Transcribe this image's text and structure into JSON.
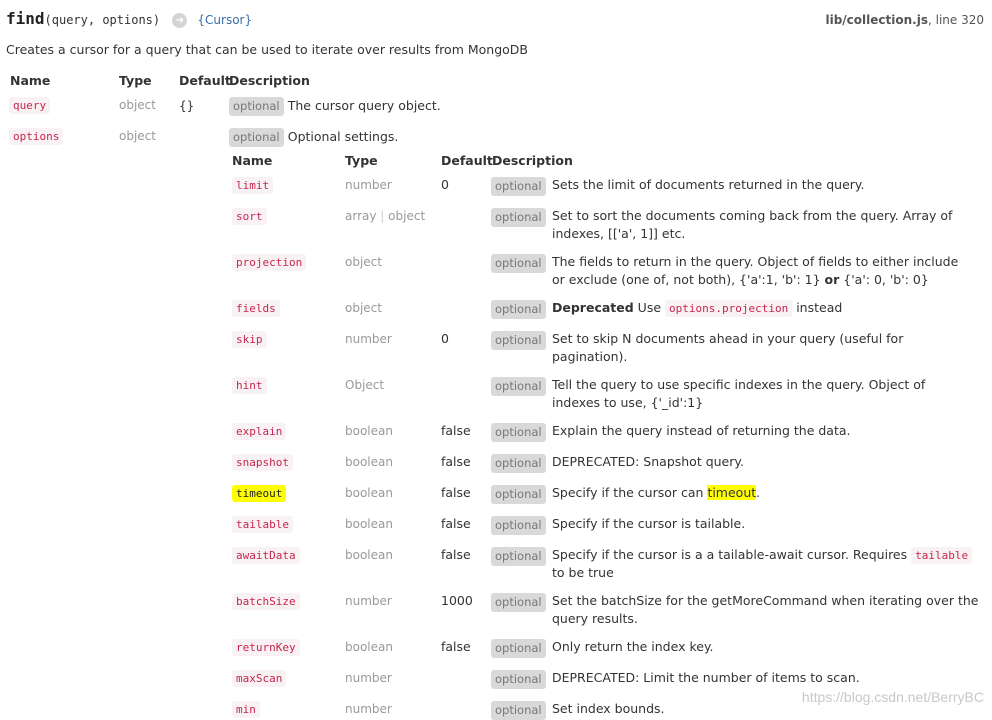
{
  "header": {
    "fn_name": "find",
    "fn_params": "(query, options)",
    "return_type": "{Cursor}",
    "source_file": "lib/collection.js",
    "source_line_label": ", line 320",
    "description": "Creates a cursor for a query that can be used to iterate over results from MongoDB"
  },
  "outer_headers": {
    "name": "Name",
    "type": "Type",
    "default": "Default",
    "description": "Description"
  },
  "outer_rows": [
    {
      "name": "query",
      "type": "object",
      "default": "{}",
      "badge": "optional",
      "desc": "The cursor query object."
    },
    {
      "name": "options",
      "type": "object",
      "default": "",
      "badge": "optional",
      "desc": "Optional settings."
    }
  ],
  "inner_headers": {
    "name": "Name",
    "type": "Type",
    "default": "Default",
    "description": "Description"
  },
  "inner_rows": [
    {
      "name": "limit",
      "type": "number",
      "default": "0",
      "badge": "optional",
      "desc_line1": "Sets the limit of documents returned in the query.",
      "desc_line2": ""
    },
    {
      "name": "sort",
      "type_a": "array",
      "type_sep": "|",
      "type_b": "object",
      "default": "",
      "badge": "optional",
      "desc_line1": "Set to sort the documents coming back from the query. Array of",
      "desc_line2": "indexes, [['a', 1]] etc."
    },
    {
      "name": "projection",
      "type": "object",
      "default": "",
      "badge": "optional",
      "desc_line1": "The fields to return in the query. Object of fields to either include",
      "desc_line2a": "or exclude (one of, not both), {'a':1, 'b': 1} ",
      "desc_line2_or": "or",
      "desc_line2b": " {'a': 0, 'b': 0}"
    },
    {
      "name": "fields",
      "type": "object",
      "default": "",
      "badge": "optional",
      "desc_bold": "Deprecated",
      "desc_use": " Use ",
      "desc_code": "options.projection",
      "desc_end": " instead"
    },
    {
      "name": "skip",
      "type": "number",
      "default": "0",
      "badge": "optional",
      "desc_line1": "Set to skip N documents ahead in your query (useful for",
      "desc_line2": "pagination)."
    },
    {
      "name": "hint",
      "type": "Object",
      "default": "",
      "badge": "optional",
      "desc_line1": "Tell the query to use specific indexes in the query. Object of",
      "desc_line2": "indexes to use, {'_id':1}"
    },
    {
      "name": "explain",
      "type": "boolean",
      "default": "false",
      "badge": "optional",
      "desc_line1": "Explain the query instead of returning the data.",
      "desc_line2": ""
    },
    {
      "name": "snapshot",
      "type": "boolean",
      "default": "false",
      "badge": "optional",
      "desc_line1": "DEPRECATED: Snapshot query.",
      "desc_line2": ""
    },
    {
      "name": "timeout",
      "type": "boolean",
      "default": "false",
      "badge": "optional",
      "desc_pre": "Specify if the cursor can ",
      "desc_hl": "timeout",
      "desc_post": "."
    },
    {
      "name": "tailable",
      "type": "boolean",
      "default": "false",
      "badge": "optional",
      "desc_line1": "Specify if the cursor is tailable.",
      "desc_line2": ""
    },
    {
      "name": "awaitData",
      "type": "boolean",
      "default": "false",
      "badge": "optional",
      "desc_pre": "Specify if the cursor is a a tailable-await cursor. Requires ",
      "desc_code": "tailable",
      "desc_line2": "to be true"
    },
    {
      "name": "batchSize",
      "type": "number",
      "default": "1000",
      "badge": "optional",
      "desc_line1": "Set the batchSize for the getMoreCommand when iterating over the",
      "desc_line2": "query results."
    },
    {
      "name": "returnKey",
      "type": "boolean",
      "default": "false",
      "badge": "optional",
      "desc_line1": "Only return the index key.",
      "desc_line2": ""
    },
    {
      "name": "maxScan",
      "type": "number",
      "default": "",
      "badge": "optional",
      "desc_line1": "DEPRECATED: Limit the number of items to scan.",
      "desc_line2": ""
    },
    {
      "name": "min",
      "type": "number",
      "default": "",
      "badge": "optional",
      "desc_line1": "Set index bounds.",
      "desc_line2": ""
    }
  ],
  "watermark": "https://blog.csdn.net/BerryBC"
}
